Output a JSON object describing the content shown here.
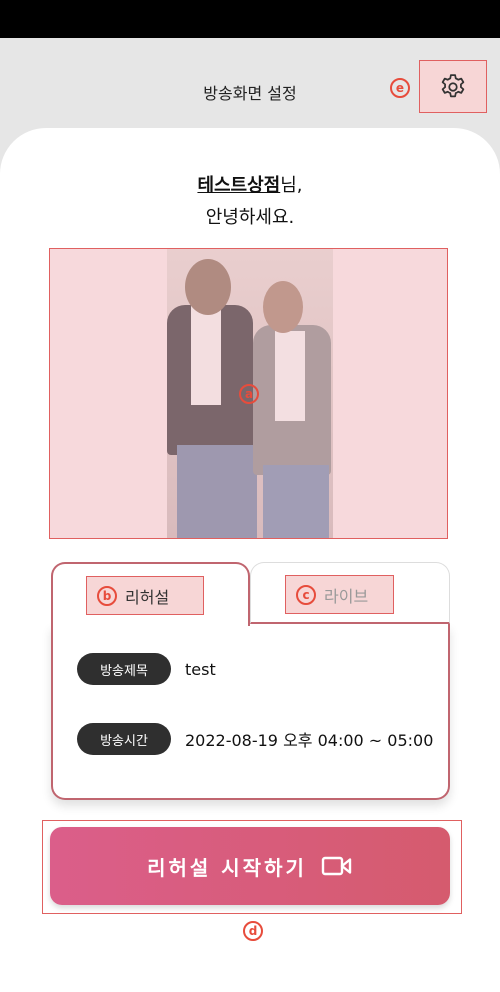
{
  "header": {
    "title": "방송화면 설정"
  },
  "greeting": {
    "shop_name": "테스트상점",
    "suffix": "님,",
    "line2": "안녕하세요."
  },
  "markers": {
    "a": "a",
    "b": "b",
    "c": "c",
    "d": "d",
    "e": "e"
  },
  "tabs": [
    {
      "label": "리허설",
      "active": true
    },
    {
      "label": "라이브",
      "active": false
    }
  ],
  "broadcast": {
    "title_label": "방송제목",
    "title_value": "test",
    "time_label": "방송시간",
    "time_value": "2022-08-19 오후 04:00 ~ 05:00"
  },
  "actions": {
    "start_label": "리허설 시작하기"
  },
  "icons": {
    "settings": "gear-icon",
    "start": "video-camera-icon"
  },
  "colors": {
    "accent": "#d55b6e",
    "gradient_start": "#db5e8a",
    "annotation": "#e74c3c",
    "pill": "#2f2f2f"
  }
}
